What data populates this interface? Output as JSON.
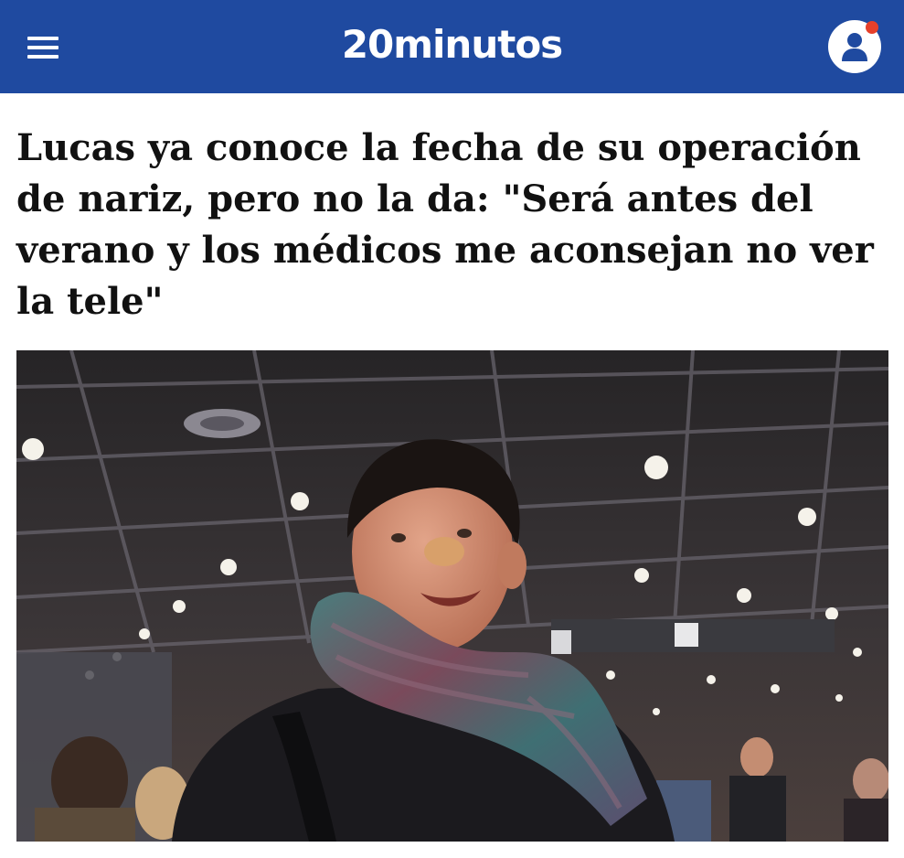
{
  "header": {
    "logo_text": "20minutos",
    "menu_icon": "hamburger-menu-icon",
    "user_icon": "user-account-icon",
    "brand_color": "#1f4aa0",
    "notification_color": "#e6402a"
  },
  "article": {
    "headline": "Lucas ya conoce la fecha de su operación de nariz, pero no la da: \"Será antes del verano y los médicos me aconsejan no ver la tele\"",
    "image_description_icon": "photo-man-with-scarf-in-station"
  }
}
